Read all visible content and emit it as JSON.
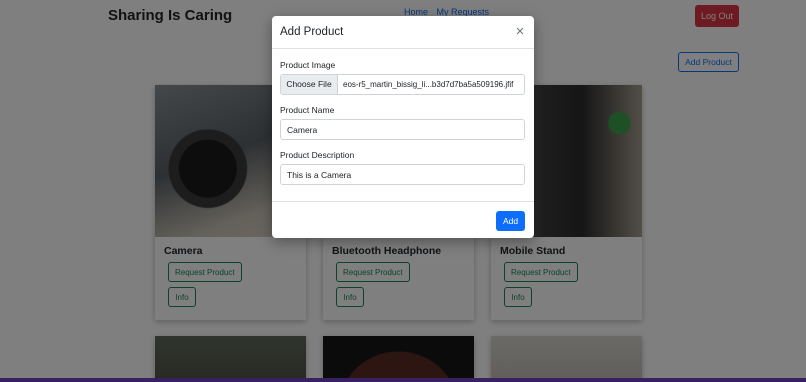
{
  "navbar": {
    "brand": "Sharing Is Caring",
    "links": [
      {
        "label": "Home"
      },
      {
        "label": "My Requests"
      }
    ],
    "logout_label": "Log Out"
  },
  "main": {
    "add_product_label": "Add Product",
    "products": [
      {
        "title": "Camera",
        "request_label": "Request Product",
        "info_label": "Info"
      },
      {
        "title": "Bluetooth Headphone",
        "request_label": "Request Product",
        "info_label": "Info"
      },
      {
        "title": "Mobile Stand",
        "request_label": "Request Product",
        "info_label": "Info"
      }
    ]
  },
  "modal": {
    "title": "Add Product",
    "close_symbol": "×",
    "image_label": "Product Image",
    "choose_file_label": "Choose File",
    "file_name": "eos-r5_martin_bissig_li...b3d7d7ba5a509196.jfif",
    "name_label": "Product Name",
    "name_value": "Camera",
    "description_label": "Product Description",
    "description_value": "This is a Camera",
    "submit_label": "Add"
  },
  "colors": {
    "primary": "#0d6efd",
    "danger": "#dc3545",
    "success": "#198754"
  }
}
